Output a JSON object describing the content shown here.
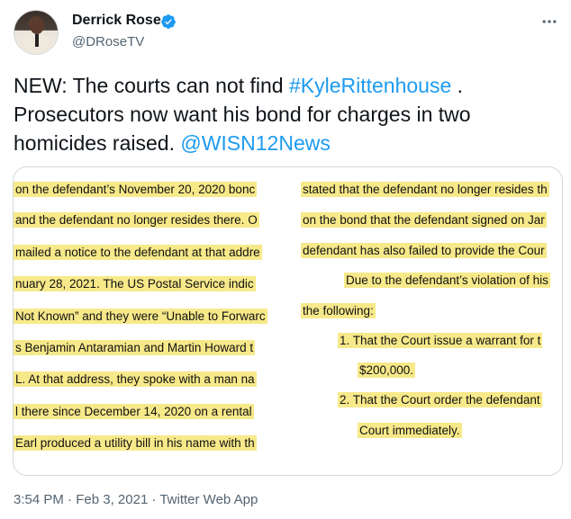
{
  "author": {
    "name": "Derrick Rose",
    "handle": "@DRoseTV"
  },
  "icons": {
    "verified": "verified-badge-icon",
    "more": "more-options-icon"
  },
  "colors": {
    "link": "#1d9bf0",
    "highlight": "#f7e98a",
    "secondary_text": "#536471"
  },
  "tweet": {
    "text_1": "NEW: The courts can not find ",
    "hashtag": "#KyleRittenhouse",
    "text_2": " . Prosecutors now want his bond for charges in two homicides raised. ",
    "mention": "@WISN12News"
  },
  "document": {
    "left_lines": [
      "on the defendant’s November 20, 2020 bonc",
      "and the defendant no longer resides there.  O",
      "mailed a notice to the defendant at that addre",
      "nuary 28, 2021.  The US Postal Service indic",
      "Not Known” and they were “Unable to Forwarc",
      "s Benjamin Antaramian and Martin Howard t",
      "L.  At that address, they spoke with a man na",
      "l there since December 14, 2020 on a rental",
      "Earl produced a utility bill in his name with th"
    ],
    "right_lines": [
      "stated that the defendant no longer resides th",
      "on the bond that the defendant signed on Jar",
      "defendant has also failed to provide the Cour",
      "Due to the defendant’s violation of his",
      "the following:",
      "1.  That the Court issue a warrant for t",
      "$200,000.",
      "2.  That the Court order the defendant",
      "Court immediately."
    ]
  },
  "footer": {
    "time": "3:54 PM",
    "sep1": " · ",
    "date": "Feb 3, 2021",
    "sep2": " · ",
    "source": "Twitter Web App"
  }
}
